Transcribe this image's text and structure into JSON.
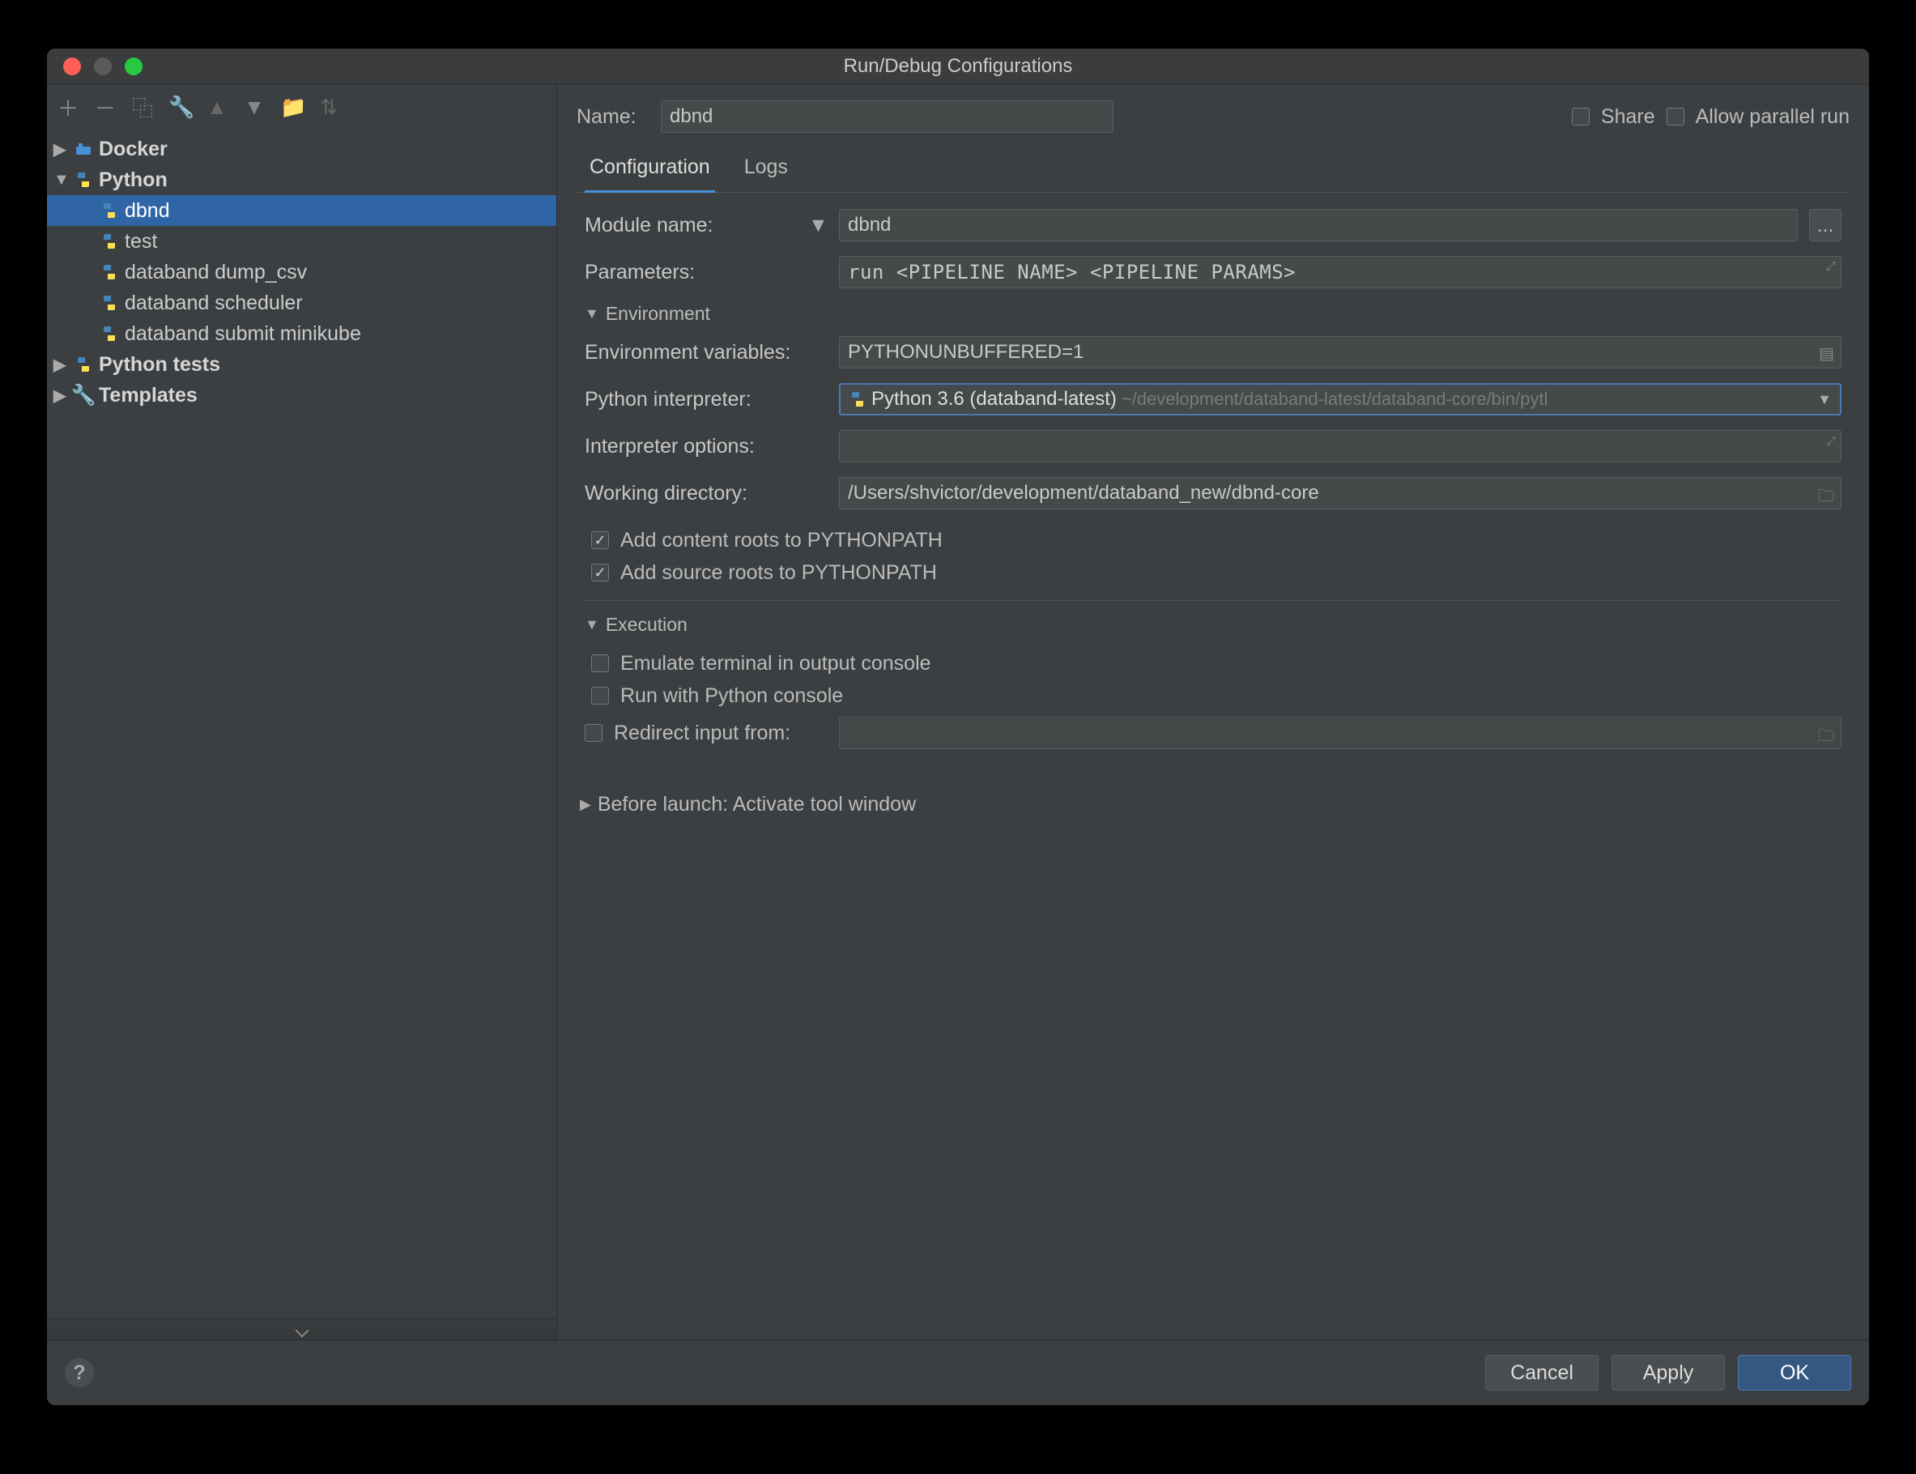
{
  "window": {
    "title": "Run/Debug Configurations"
  },
  "header": {
    "name_label": "Name:",
    "name_value": "dbnd",
    "share_label": "Share",
    "allow_parallel_label": "Allow parallel run"
  },
  "tabs": {
    "configuration": "Configuration",
    "logs": "Logs"
  },
  "tree": {
    "docker": "Docker",
    "python": "Python",
    "python_children": [
      "dbnd",
      "test",
      "databand dump_csv",
      "databand scheduler",
      "databand submit minikube"
    ],
    "python_tests": "Python tests",
    "templates": "Templates"
  },
  "form": {
    "module_label": "Module name:",
    "module_value": "dbnd",
    "param_label": "Parameters:",
    "param_value": "run <PIPELINE NAME> <PIPELINE PARAMS>",
    "env_section": "Environment",
    "envvars_label": "Environment variables:",
    "envvars_value": "PYTHONUNBUFFERED=1",
    "interp_label": "Python interpreter:",
    "interp_name": "Python 3.6 (databand-latest)",
    "interp_path": "~/development/databand-latest/databand-core/bin/pytl",
    "interp_opts_label": "Interpreter options:",
    "workdir_label": "Working directory:",
    "workdir_value": "/Users/shvictor/development/databand_new/dbnd-core",
    "add_content_roots": "Add content roots to PYTHONPATH",
    "add_source_roots": "Add source roots to PYTHONPATH",
    "exec_section": "Execution",
    "emulate_terminal": "Emulate terminal in output console",
    "run_with_console": "Run with Python console",
    "redirect_input": "Redirect input from:",
    "before_launch": "Before launch: Activate tool window"
  },
  "footer": {
    "cancel": "Cancel",
    "apply": "Apply",
    "ok": "OK",
    "more": "..."
  }
}
